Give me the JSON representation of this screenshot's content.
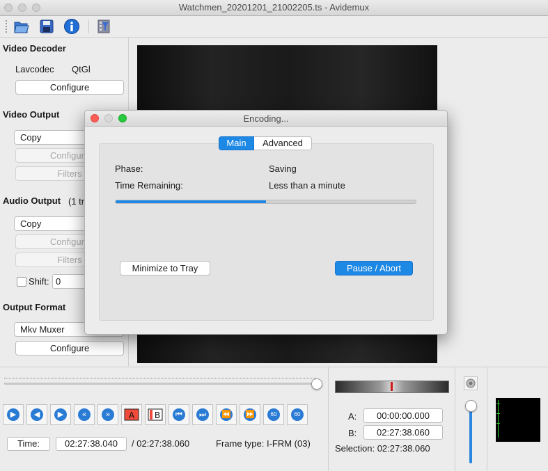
{
  "window": {
    "title": "Watchmen_20201201_21002205.ts - Avidemux"
  },
  "toolbar": {
    "icons": [
      "open-icon",
      "save-icon",
      "info-icon",
      "filter-icon"
    ]
  },
  "left": {
    "video_decoder": {
      "heading": "Video Decoder",
      "lavcodec": "Lavcodec",
      "qtgl": "QtGl",
      "configure": "Configure"
    },
    "video_output": {
      "heading": "Video Output",
      "codec": "Copy",
      "configure": "Configure",
      "filters": "Filters"
    },
    "audio_output": {
      "heading": "Audio Output",
      "tracks": "(1 tr",
      "codec": "Copy",
      "configure": "Configure",
      "filters": "Filters",
      "shift_label": "Shift:",
      "shift_value": "0"
    },
    "output_format": {
      "heading": "Output Format",
      "muxer": "Mkv Muxer",
      "configure": "Configure"
    }
  },
  "dialog": {
    "title": "Encoding...",
    "tabs": [
      "Main",
      "Advanced"
    ],
    "phase_label": "Phase:",
    "phase_value": "Saving",
    "time_label": "Time Remaining:",
    "time_value": "Less than a minute",
    "progress": 0.5,
    "minimize": "Minimize to Tray",
    "pause": "Pause / Abort"
  },
  "bottom": {
    "time_label": "Time:",
    "time_value": "02:27:38.040",
    "total": "/ 02:27:38.060",
    "frame_type": "Frame type:  I-FRM (03)",
    "a_label": "A:",
    "a_value": "00:00:00.000",
    "b_label": "B:",
    "b_value": "02:27:38.060",
    "selection": "Selection: 02:27:38.060",
    "seek_position": 1.0
  },
  "colors": {
    "accent": "#1e88e5",
    "red": "#fd5f57",
    "yellow": "#d8d8d8",
    "green": "#28c840"
  }
}
